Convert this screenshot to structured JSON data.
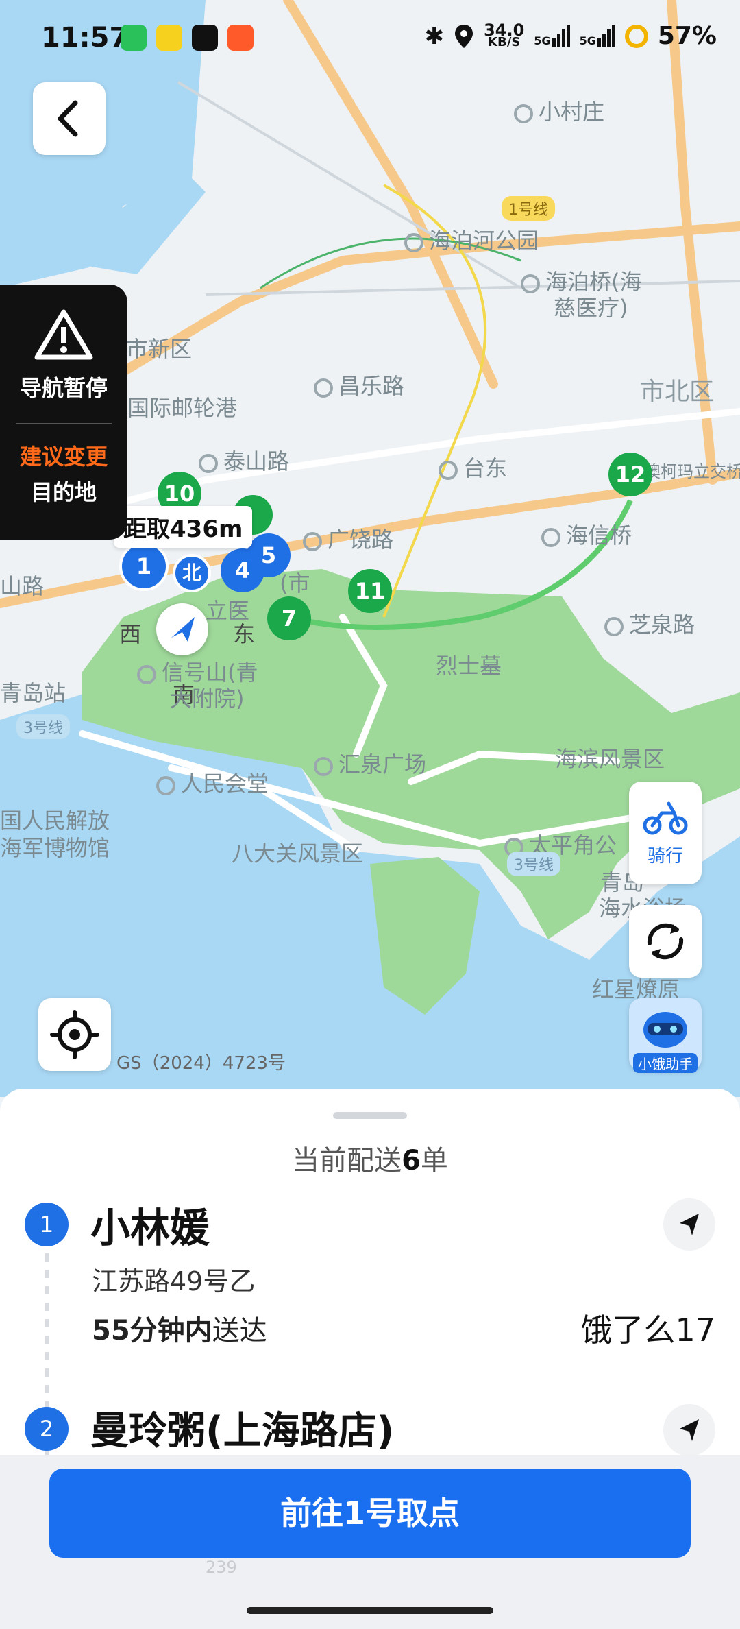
{
  "status_bar": {
    "time": "11:57",
    "net_speed_value": "34.0",
    "net_speed_unit": "KB/S",
    "battery": "57%",
    "signal_1_label": "5G",
    "signal_2_label": "5G"
  },
  "map": {
    "labels": {
      "xiaocunzhuang": "小村庄",
      "line1_badge": "1号线",
      "haibohe_park": "海泊河公园",
      "haibo_bridge_1": "海泊桥(海",
      "haibo_bridge_2": "慈医疗)",
      "shinan_new": "市新区",
      "changle_rd": "昌乐路",
      "shibei_district": "市北区",
      "intl_cruise_port": "国际邮轮港",
      "taishan_rd": "泰山路",
      "taidong": "台东",
      "coca_cola": "澳柯玛立交桥",
      "guangrao_rd": "广饶路",
      "haixin_bridge": "海信桥",
      "shanlu": "山路",
      "zhiquan_rd": "芝泉路",
      "xi": "西",
      "dong": "东",
      "bei": "北",
      "nan": "南",
      "shi": "(市",
      "li": "立医",
      "xinhaoshan_1": "信号山(青",
      "xinhaoshan_2": "大附院)",
      "lieshimu": "烈士墓",
      "qingdao_station": "青岛站",
      "line3_badge_1": "3号线",
      "huiquan_square": "汇泉广场",
      "haibin_scenic": "海滨风景区",
      "pla_navy_1": "国人民解放",
      "pla_navy_2": "海军博物馆",
      "renmin_hall": "人民会堂",
      "badaguan": "八大关风景区",
      "taipingjiao": "太平角公",
      "line3_badge_2": "3号线",
      "qingdao_ocean_1": "青岛",
      "qingdao_ocean_2": "海水浴场",
      "hongxing": "红星燎原",
      "map_copyright": "GS（2024）4723号"
    },
    "distance_label": "距取436m",
    "pins": [
      "1",
      "4",
      "5",
      "7",
      "10",
      "11",
      "12"
    ]
  },
  "pause_card": {
    "warning_icon": "warning-triangle-icon",
    "title": "导航暂停",
    "suggest": "建议变更",
    "destination": "目的地"
  },
  "side_buttons": {
    "ride_label": "骑行",
    "assistant_label": "小饿助手"
  },
  "sheet": {
    "summary_prefix": "当前配送",
    "summary_count": "6",
    "summary_suffix": "单",
    "orders": [
      {
        "index": "1",
        "name": "小林媛",
        "address": "江苏路49号乙",
        "time_bold": "55分钟内",
        "time_suffix": "送达",
        "platform": "饿了么17"
      },
      {
        "index": "2",
        "name": "曼玲粥(上海路店)"
      }
    ],
    "footer_faint_number": "239"
  },
  "go_button": "前往1号取点",
  "colors": {
    "accent_blue": "#1a6ef0",
    "pin_green": "#1aa84a",
    "warning_orange": "#ff6a1a",
    "sea_blue": "#a9d8f5",
    "park_green": "#9fd99a"
  }
}
